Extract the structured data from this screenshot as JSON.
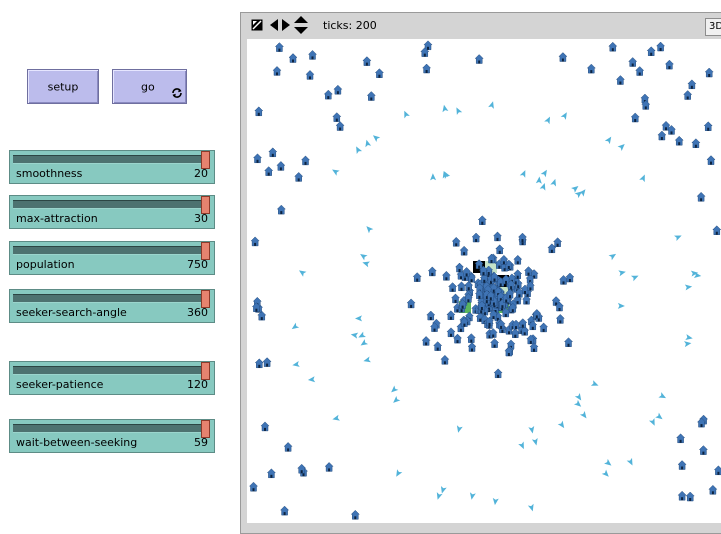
{
  "buttons": {
    "setup_label": "setup",
    "go_label": "go"
  },
  "sliders": [
    {
      "label": "smoothness",
      "value": "20",
      "level": 1.0
    },
    {
      "label": "max-attraction",
      "value": "30",
      "level": 1.0
    },
    {
      "label": "population",
      "value": "750",
      "level": 1.0
    },
    {
      "label": "seeker-search-angle",
      "value": "360",
      "level": 1.0
    },
    {
      "label": "seeker-patience",
      "value": "120",
      "level": 1.0
    },
    {
      "label": "wait-between-seeking",
      "value": "59",
      "level": 1.0
    }
  ],
  "view": {
    "ticks_label": "ticks: 200",
    "three_d_label": "3D",
    "icons": [
      "zoom-toggle-icon",
      "horizontal-arrows-icon",
      "vertical-arrows-icon"
    ],
    "colors": {
      "background": "#ffffff",
      "house": "#3f74b5",
      "seeker_arrow": "#52b3d9",
      "patch_black": "#000000",
      "patch_pale_green": "#c5e3c8",
      "patch_green": "#5ab55e"
    }
  },
  "colors": {
    "button": "#bcbcec",
    "slider": "#87c9c0",
    "slider_thumb": "#e6836f",
    "frame": "#d4d4d4"
  }
}
